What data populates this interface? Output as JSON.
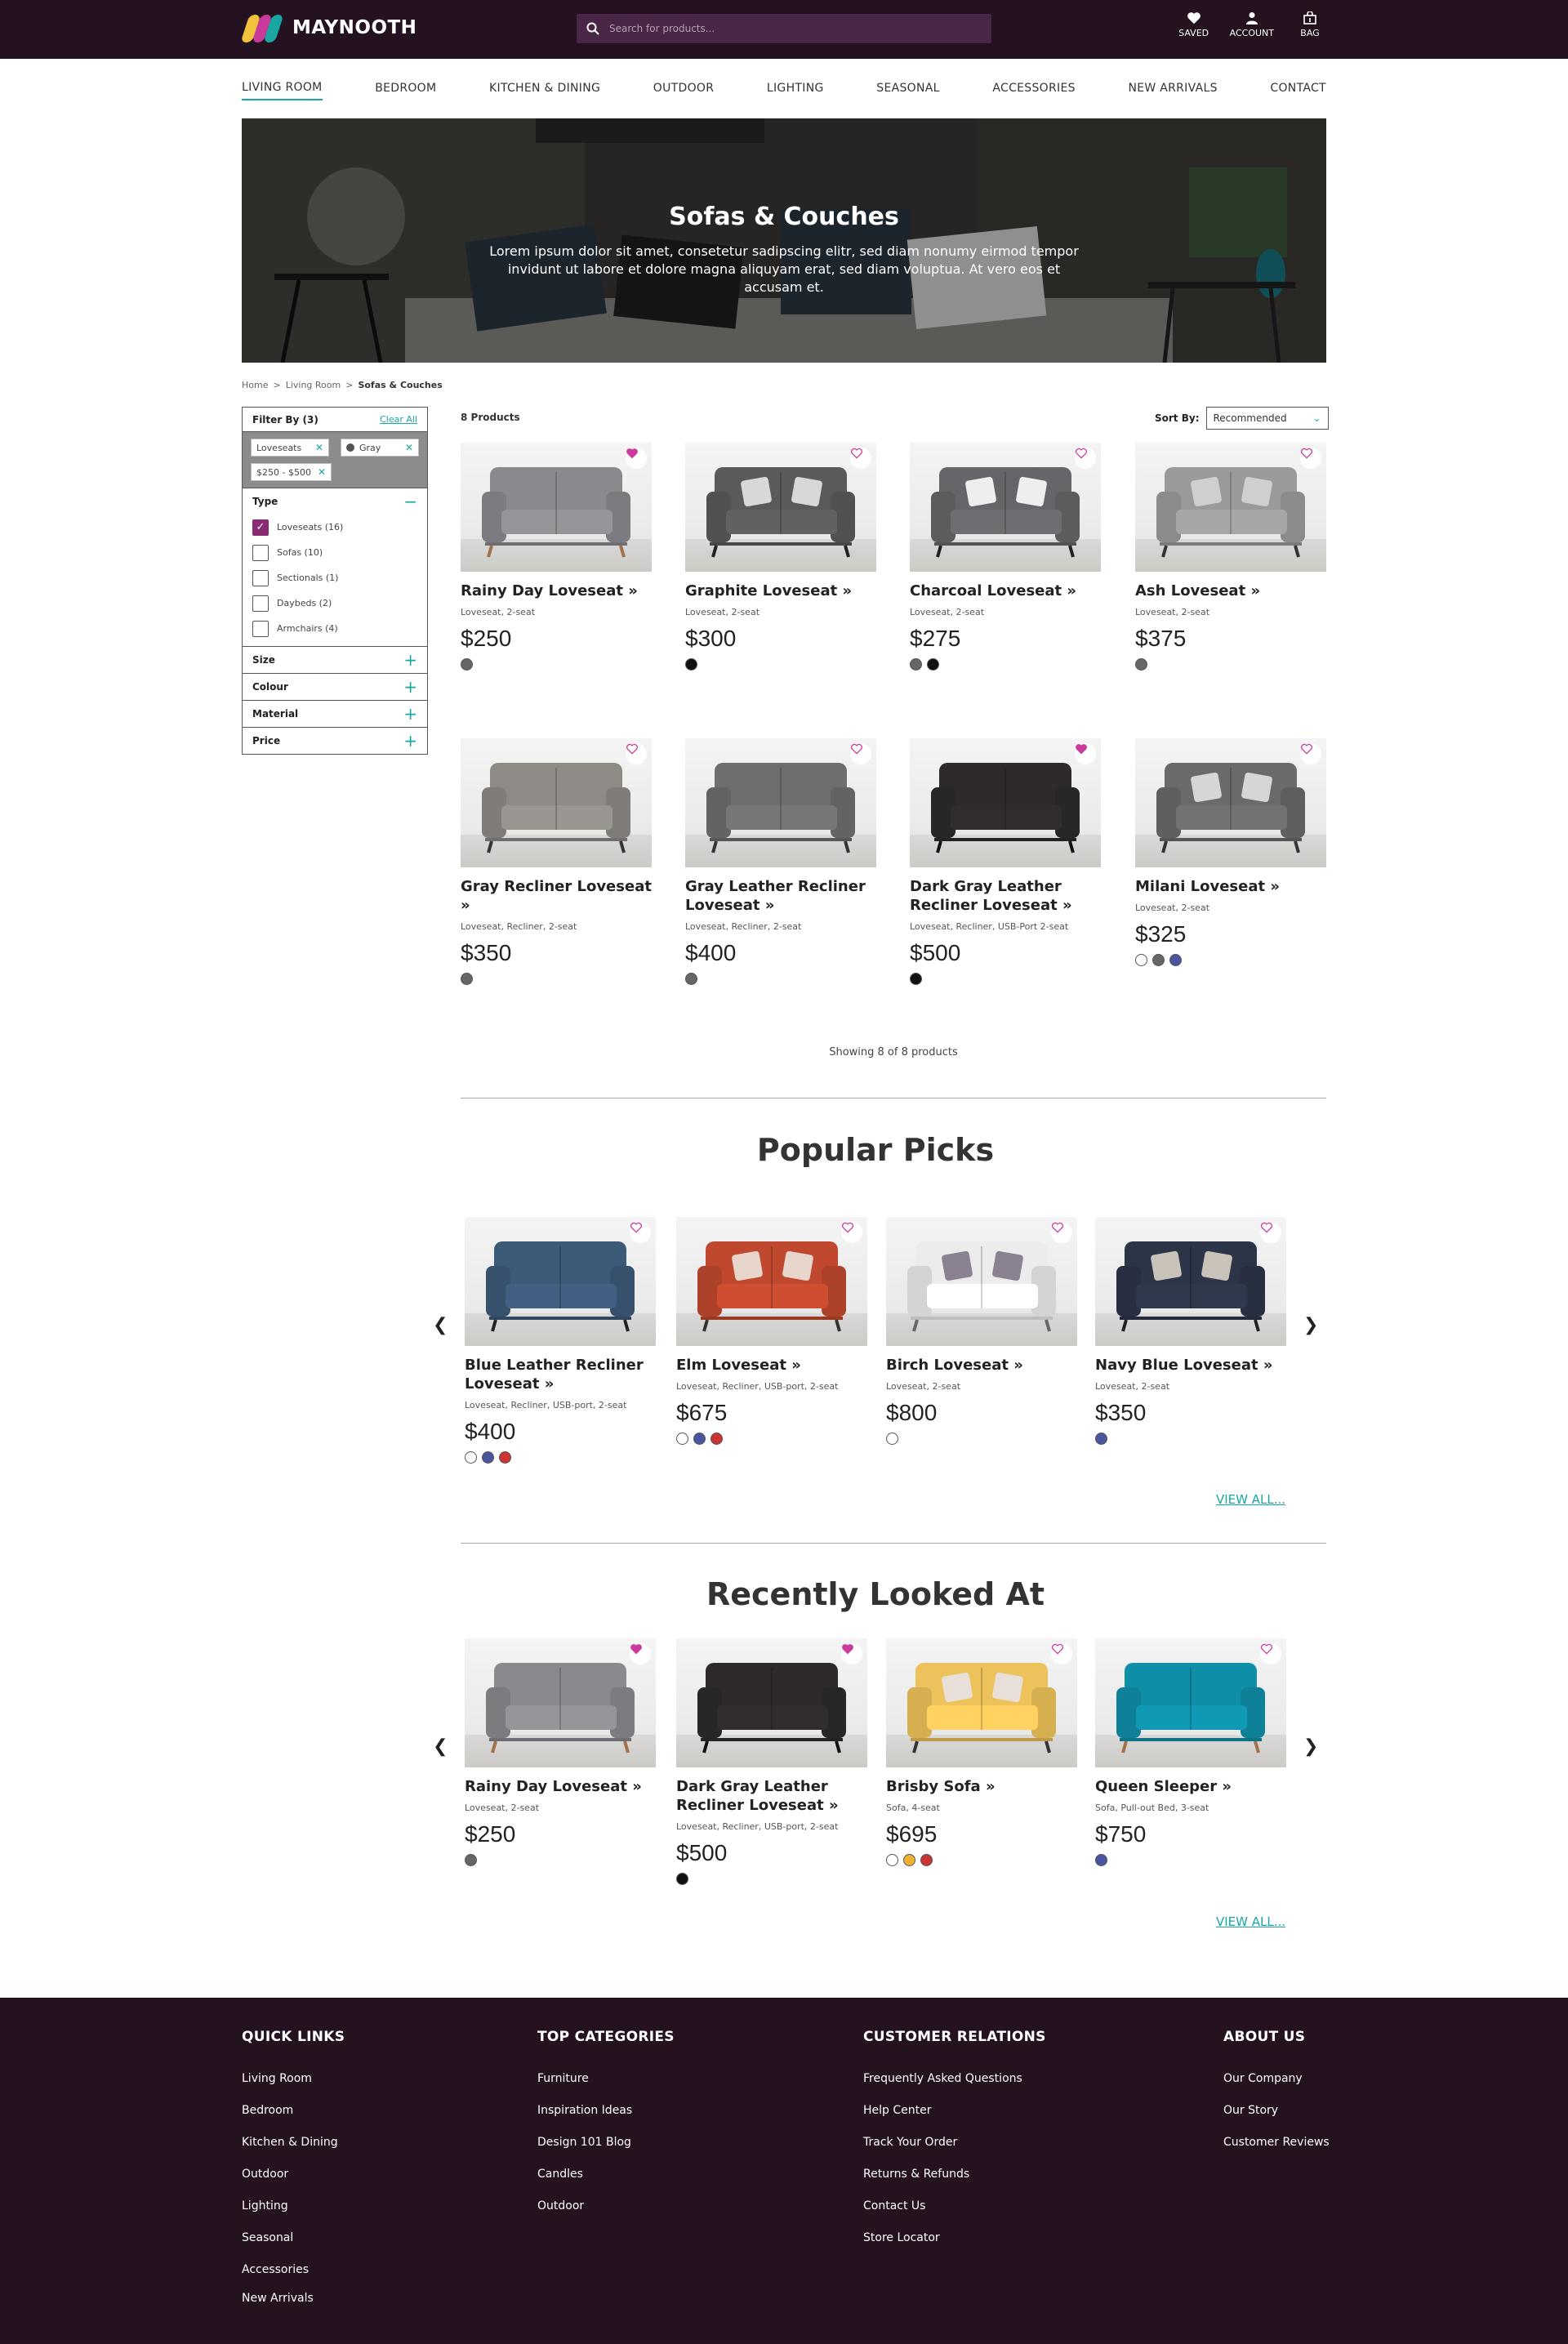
{
  "header": {
    "logo_text": "MAYNOOTH",
    "search_placeholder": "Search for products...",
    "icons": [
      {
        "label": "SAVED",
        "icon": "heart-icon"
      },
      {
        "label": "ACCOUNT",
        "icon": "user-icon"
      },
      {
        "label": "BAG",
        "icon": "bag-icon"
      }
    ]
  },
  "nav": [
    "LIVING ROOM",
    "BEDROOM",
    "KITCHEN & DINING",
    "OUTDOOR",
    "LIGHTING",
    "SEASONAL",
    "ACCESSORIES",
    "NEW ARRIVALS",
    "CONTACT"
  ],
  "hero": {
    "title": "Sofas & Couches",
    "subtitle": "Lorem ipsum dolor sit amet, consetetur sadipscing elitr, sed diam nonumy eirmod tempor invidunt ut labore et dolore magna aliquyam erat, sed diam voluptua. At vero eos et accusam et."
  },
  "breadcrumb": [
    "Home",
    ">",
    "Living Room",
    ">",
    "Sofas & Couches"
  ],
  "filter": {
    "title": "Filter By (3)",
    "clear_all": "Clear All",
    "chips": [
      "Loveseats",
      "Gray",
      "$250 - $500"
    ],
    "type_label": "Type",
    "types": [
      {
        "label": "Loveseats (16)",
        "checked": true
      },
      {
        "label": "Sofas (10)",
        "checked": false
      },
      {
        "label": "Sectionals (1)",
        "checked": false
      },
      {
        "label": "Daybeds (2)",
        "checked": false
      },
      {
        "label": "Armchairs (4)",
        "checked": false
      }
    ],
    "sections": [
      "Size",
      "Colour",
      "Material",
      "Price"
    ]
  },
  "listing": {
    "count": "8 Products",
    "sort_label": "Sort By:",
    "sort_value": "Recommended",
    "showing": "Showing 8 of 8 products",
    "products": [
      {
        "name": "Rainy Day Loveseat »",
        "meta": "Loveseat, 2-seat",
        "price": "$250",
        "saved": true,
        "colors": [
          "#666666"
        ],
        "sofa": "#8a8a8e",
        "legs": "#a0704a",
        "pillows": null
      },
      {
        "name": "Graphite Loveseat »",
        "meta": "Loveseat, 2-seat",
        "price": "$300",
        "saved": false,
        "colors": [
          "#111111"
        ],
        "sofa": "#5a5a5c",
        "legs": "#222222",
        "pillows": "#d8d8d8"
      },
      {
        "name": "Charcoal Loveseat »",
        "meta": "Loveseat, 2-seat",
        "price": "$275",
        "saved": false,
        "colors": [
          "#666666",
          "#111111"
        ],
        "sofa": "#66666a",
        "legs": "#222222",
        "pillows": "#eeeeee"
      },
      {
        "name": "Ash Loveseat »",
        "meta": "Loveseat, 2-seat",
        "price": "$375",
        "saved": false,
        "colors": [
          "#666666"
        ],
        "sofa": "#9a9a9c",
        "legs": "#333333",
        "pillows": "#cfcfcf"
      },
      {
        "name": "Gray Recliner Loveseat »",
        "meta": "Loveseat, Recliner, 2-seat",
        "price": "$350",
        "saved": false,
        "colors": [
          "#666666"
        ],
        "sofa": "#8e8a86",
        "legs": "#333333",
        "pillows": null
      },
      {
        "name": "Gray Leather Recliner Loveseat »",
        "meta": "Loveseat, Recliner, 2-seat",
        "price": "$400",
        "saved": false,
        "colors": [
          "#666666"
        ],
        "sofa": "#6e6e6e",
        "legs": "#333333",
        "pillows": null
      },
      {
        "name": "Dark Gray Leather Recliner Loveseat »",
        "meta": "Loveseat, Recliner, USB-Port 2-seat",
        "price": "$500",
        "saved": true,
        "colors": [
          "#111111"
        ],
        "sofa": "#2e2a2a",
        "legs": "#111111",
        "pillows": null
      },
      {
        "name": "Milani Loveseat »",
        "meta": "Loveseat, 2-seat",
        "price": "$325",
        "saved": false,
        "colors": [
          "#ffffff",
          "#666666",
          "#4a55a0"
        ],
        "sofa": "#6a6a6c",
        "legs": "#333333",
        "pillows": "#d6d6d6"
      }
    ]
  },
  "popular": {
    "title": "Popular Picks",
    "view_all": "VIEW ALL...",
    "products": [
      {
        "name": "Blue Leather Recliner Loveseat »",
        "meta": "Loveseat, Recliner, USB-port, 2-seat",
        "price": "$400",
        "saved": false,
        "colors": [
          "#ffffff",
          "#4a55a0",
          "#cc3333"
        ],
        "sofa": "#3d5a78",
        "legs": "#222222",
        "pillows": null
      },
      {
        "name": "Elm Loveseat »",
        "meta": "Loveseat, Recliner, USB-port, 2-seat",
        "price": "$675",
        "saved": false,
        "colors": [
          "#ffffff",
          "#4a55a0",
          "#cc3333"
        ],
        "sofa": "#c0482e",
        "legs": "#333333",
        "pillows": "#e8d6cc"
      },
      {
        "name": "Birch Loveseat »",
        "meta": "Loveseat, 2-seat",
        "price": "$800",
        "saved": false,
        "colors": [
          "#ffffff"
        ],
        "sofa": "#ececec",
        "legs": "#666666",
        "pillows": "#8a8290"
      },
      {
        "name": "Navy Blue Loveseat »",
        "meta": "Loveseat, 2-seat",
        "price": "$350",
        "saved": false,
        "colors": [
          "#4a55a0"
        ],
        "sofa": "#2c3448",
        "legs": "#222222",
        "pillows": "#c8c2b8"
      }
    ]
  },
  "recent": {
    "title": "Recently Looked At",
    "view_all": "VIEW ALL...",
    "products": [
      {
        "name": "Rainy Day Loveseat »",
        "meta": "Loveseat, 2-seat",
        "price": "$250",
        "saved": true,
        "colors": [
          "#666666"
        ],
        "sofa": "#8a8a8e",
        "legs": "#a0704a",
        "pillows": null
      },
      {
        "name": "Dark Gray Leather Recliner Loveseat »",
        "meta": "Loveseat, Recliner, USB-port, 2-seat",
        "price": "$500",
        "saved": true,
        "colors": [
          "#111111"
        ],
        "sofa": "#2e2a2a",
        "legs": "#111111",
        "pillows": null
      },
      {
        "name": "Brisby Sofa »",
        "meta": "Sofa, 4-seat",
        "price": "$695",
        "saved": false,
        "colors": [
          "#ffffff",
          "#f0b030",
          "#cc3333"
        ],
        "sofa": "#eec25a",
        "legs": "#333333",
        "pillows": "#e8e0d8"
      },
      {
        "name": "Queen Sleeper »",
        "meta": "Sofa, Pull-out Bed, 3-seat",
        "price": "$750",
        "saved": false,
        "colors": [
          "#4a55a0"
        ],
        "sofa": "#0f8ea8",
        "legs": "#a0704a",
        "pillows": null
      }
    ]
  },
  "footer": {
    "columns": [
      {
        "title": "QUICK LINKS",
        "links": [
          "Living Room",
          "Bedroom",
          "Kitchen & Dining",
          "Outdoor",
          "Lighting",
          "Seasonal",
          "Accessories",
          "New Arrivals"
        ]
      },
      {
        "title": "TOP CATEGORIES",
        "links": [
          "Furniture",
          "Inspiration Ideas",
          "Design 101 Blog",
          "Candles",
          "Outdoor"
        ]
      },
      {
        "title": "CUSTOMER RELATIONS",
        "links": [
          "Frequently Asked Questions",
          "Help Center",
          "Track Your Order",
          "Returns & Refunds",
          "Contact Us",
          "Store Locator"
        ]
      },
      {
        "title": "ABOUT US",
        "links": [
          "Our Company",
          "Our Story",
          "Customer Reviews"
        ]
      }
    ]
  },
  "colors": {
    "brand_dark": "#241221",
    "accent_teal": "#1aa7a3",
    "saved_pink": "#cc3a9e",
    "check_purple": "#8a2a72"
  }
}
